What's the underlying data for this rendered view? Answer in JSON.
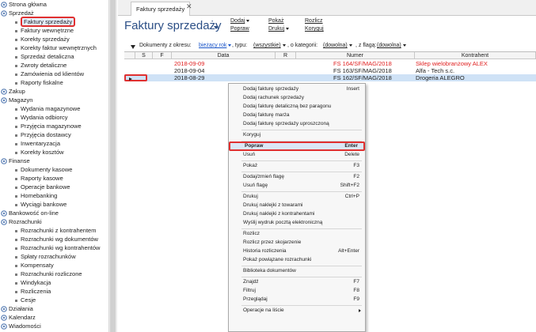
{
  "sidebar": {
    "items": [
      {
        "label": "Strona główna",
        "kind": "group",
        "icon": "home-icon"
      },
      {
        "label": "Sprzedaż",
        "kind": "group",
        "icon": "sales-icon"
      },
      {
        "label": "Faktury sprzedaży",
        "kind": "leaf",
        "selected": true
      },
      {
        "label": "Faktury wewnętrzne",
        "kind": "leaf"
      },
      {
        "label": "Korekty sprzedaży",
        "kind": "leaf"
      },
      {
        "label": "Korekty faktur wewnętrznych",
        "kind": "leaf"
      },
      {
        "label": "Sprzedaż detaliczna",
        "kind": "leaf"
      },
      {
        "label": "Zwroty detaliczne",
        "kind": "leaf"
      },
      {
        "label": "Zamówienia od klientów",
        "kind": "leaf"
      },
      {
        "label": "Raporty fiskalne",
        "kind": "leaf"
      },
      {
        "label": "Zakup",
        "kind": "group",
        "icon": "purchase-icon"
      },
      {
        "label": "Magazyn",
        "kind": "group",
        "icon": "warehouse-icon"
      },
      {
        "label": "Wydania magazynowe",
        "kind": "leaf"
      },
      {
        "label": "Wydania odbiorcy",
        "kind": "leaf"
      },
      {
        "label": "Przyjęcia magazynowe",
        "kind": "leaf"
      },
      {
        "label": "Przyjęcia dostawcy",
        "kind": "leaf"
      },
      {
        "label": "Inwentaryzacja",
        "kind": "leaf"
      },
      {
        "label": "Korekty kosztów",
        "kind": "leaf"
      },
      {
        "label": "Finanse",
        "kind": "group",
        "icon": "finance-icon"
      },
      {
        "label": "Dokumenty kasowe",
        "kind": "leaf"
      },
      {
        "label": "Raporty kasowe",
        "kind": "leaf"
      },
      {
        "label": "Operacje bankowe",
        "kind": "leaf"
      },
      {
        "label": "Homebanking",
        "kind": "leaf"
      },
      {
        "label": "Wyciągi bankowe",
        "kind": "leaf"
      },
      {
        "label": "Bankowość on-line",
        "kind": "group",
        "icon": "bank-icon"
      },
      {
        "label": "Rozrachunki",
        "kind": "group",
        "icon": "settlements-icon"
      },
      {
        "label": "Rozrachunki z kontrahentem",
        "kind": "leaf"
      },
      {
        "label": "Rozrachunki wg dokumentów",
        "kind": "leaf"
      },
      {
        "label": "Rozrachunki wg kontrahentów",
        "kind": "leaf"
      },
      {
        "label": "Spłaty rozrachunków",
        "kind": "leaf"
      },
      {
        "label": "Kompensaty",
        "kind": "leaf"
      },
      {
        "label": "Rozrachunki rozliczone",
        "kind": "leaf"
      },
      {
        "label": "Windykacja",
        "kind": "leaf"
      },
      {
        "label": "Rozliczenia",
        "kind": "leaf"
      },
      {
        "label": "Cesje",
        "kind": "leaf"
      },
      {
        "label": "Działania",
        "kind": "group",
        "icon": "actions-icon"
      },
      {
        "label": "Kalendarz",
        "kind": "group",
        "icon": "calendar-icon"
      },
      {
        "label": "Wiadomości",
        "kind": "group",
        "icon": "messages-icon"
      }
    ]
  },
  "tab": {
    "label": "Faktury sprzedaży",
    "close": "✕"
  },
  "header": {
    "title": "Faktury sprzedaży",
    "commands": {
      "dodaj": "Dodaj",
      "popraw": "Popraw",
      "pokaz": "Pokaż",
      "drukuj": "Drukuj",
      "rozlicz": "Rozlicz",
      "koryguj": "Koryguj"
    }
  },
  "filters": {
    "prefix": "Dokumenty z okresu:",
    "period": "bieżący rok",
    "type_label": ", typu:",
    "type_value": "(wszystkie)",
    "category_label": ", o kategorii:",
    "category_value": "(dowolna)",
    "flag_label": ", z flagą:",
    "flag_value": "(dowolna)"
  },
  "grid": {
    "columns": {
      "s": "S",
      "f": "F",
      "data": "Data",
      "r": "R",
      "numer": "Numer",
      "kontrahent": "Kontrahent"
    },
    "rows": [
      {
        "data": "2018-09-09",
        "numer": "FS 164/SF/MAG/2018",
        "kontrahent": "Sklep wielobranżowy  ALEX",
        "red": true
      },
      {
        "data": "2018-09-04",
        "numer": "FS 163/SF/MAG/2018",
        "kontrahent": "Alfa - Tech s.c.",
        "red": false
      },
      {
        "data": "2018-08-29",
        "numer": "FS 162/SF/MAG/2018",
        "kontrahent": "Drogeria ALEGRO",
        "red": false,
        "selected": true
      }
    ]
  },
  "context_menu": {
    "items": [
      {
        "label": "Dodaj fakturę sprzedaży",
        "shortcut": "Insert"
      },
      {
        "label": "Dodaj rachunek sprzedaży",
        "shortcut": ""
      },
      {
        "label": "Dodaj fakturę detaliczną bez paragonu",
        "shortcut": ""
      },
      {
        "label": "Dodaj fakturę marża",
        "shortcut": ""
      },
      {
        "label": "Dodaj fakturę sprzedaży uproszczoną",
        "shortcut": ""
      },
      {
        "sep": true
      },
      {
        "label": "Koryguj",
        "shortcut": ""
      },
      {
        "sep": true
      },
      {
        "label": "Popraw",
        "shortcut": "Enter",
        "highlight": true
      },
      {
        "label": "Usuń",
        "shortcut": "Delete"
      },
      {
        "sep": true
      },
      {
        "label": "Pokaż",
        "shortcut": "F3"
      },
      {
        "sep": true
      },
      {
        "label": "Dodaj/zmień flagę",
        "shortcut": "F2"
      },
      {
        "label": "Usuń flagę",
        "shortcut": "Shift+F2"
      },
      {
        "sep": true
      },
      {
        "label": "Drukuj",
        "shortcut": "Ctrl+P"
      },
      {
        "label": "Drukuj naklejki z towarami",
        "shortcut": ""
      },
      {
        "label": "Drukuj naklejki z kontrahentami",
        "shortcut": ""
      },
      {
        "label": "Wyślij wydruk pocztą elektroniczną",
        "shortcut": ""
      },
      {
        "sep": true
      },
      {
        "label": "Rozlicz",
        "shortcut": ""
      },
      {
        "label": "Rozlicz przez skojarzenie",
        "shortcut": ""
      },
      {
        "label": "Historia rozliczenia",
        "shortcut": "Alt+Enter"
      },
      {
        "label": "Pokaż powiązane rozrachunki",
        "shortcut": ""
      },
      {
        "sep": true
      },
      {
        "label": "Biblioteka dokumentów",
        "shortcut": ""
      },
      {
        "sep": true
      },
      {
        "label": "Znajdź",
        "shortcut": "F7"
      },
      {
        "label": "Filtruj",
        "shortcut": "F8"
      },
      {
        "label": "Przeglądaj",
        "shortcut": "F9"
      },
      {
        "sep": true
      },
      {
        "label": "Operacje na liście",
        "shortcut": "",
        "submenu": true
      }
    ]
  },
  "colors": {
    "accent": "#2c4f86",
    "link": "#1a55c8",
    "alert_red": "#e02020",
    "highlight_border": "#e03030"
  }
}
